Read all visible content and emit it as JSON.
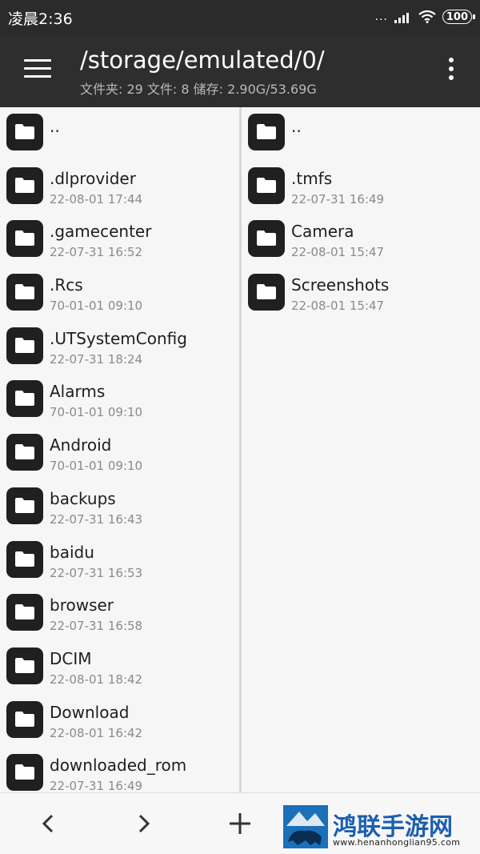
{
  "status_bar": {
    "time": "凌晨2:36",
    "dots": "...",
    "battery": "100"
  },
  "header": {
    "path": "/storage/emulated/0/",
    "stats": "文件夹: 29  文件: 8  储存: 2.90G/53.69G"
  },
  "left_pane": {
    "items": [
      {
        "name": "..",
        "date": ""
      },
      {
        "name": ".dlprovider",
        "date": "22-08-01 17:44"
      },
      {
        "name": ".gamecenter",
        "date": "22-07-31 16:52"
      },
      {
        "name": ".Rcs",
        "date": "70-01-01 09:10"
      },
      {
        "name": ".UTSystemConfig",
        "date": "22-07-31 18:24"
      },
      {
        "name": "Alarms",
        "date": "70-01-01 09:10"
      },
      {
        "name": "Android",
        "date": "70-01-01 09:10"
      },
      {
        "name": "backups",
        "date": "22-07-31 16:43"
      },
      {
        "name": "baidu",
        "date": "22-07-31 16:53"
      },
      {
        "name": "browser",
        "date": "22-07-31 16:58"
      },
      {
        "name": "DCIM",
        "date": "22-08-01 18:42"
      },
      {
        "name": "Download",
        "date": "22-08-01 16:42"
      },
      {
        "name": "downloaded_rom",
        "date": "22-07-31 16:49"
      }
    ]
  },
  "right_pane": {
    "items": [
      {
        "name": "..",
        "date": ""
      },
      {
        "name": ".tmfs",
        "date": "22-07-31 16:49"
      },
      {
        "name": "Camera",
        "date": "22-08-01 15:47"
      },
      {
        "name": "Screenshots",
        "date": "22-08-01 15:47"
      }
    ]
  },
  "bottom_bar": {
    "buttons": [
      "chevron-left-icon",
      "chevron-right-icon",
      "plus-icon"
    ]
  },
  "watermark": {
    "title": "鸿联手游网",
    "url": "www.henanhonglian95.com"
  },
  "colors": {
    "header_bg": "#2e2e2e",
    "folder_icon": "#202020",
    "pane_bg": "#f6f6f6",
    "watermark_blue": "#1c6fb9"
  }
}
